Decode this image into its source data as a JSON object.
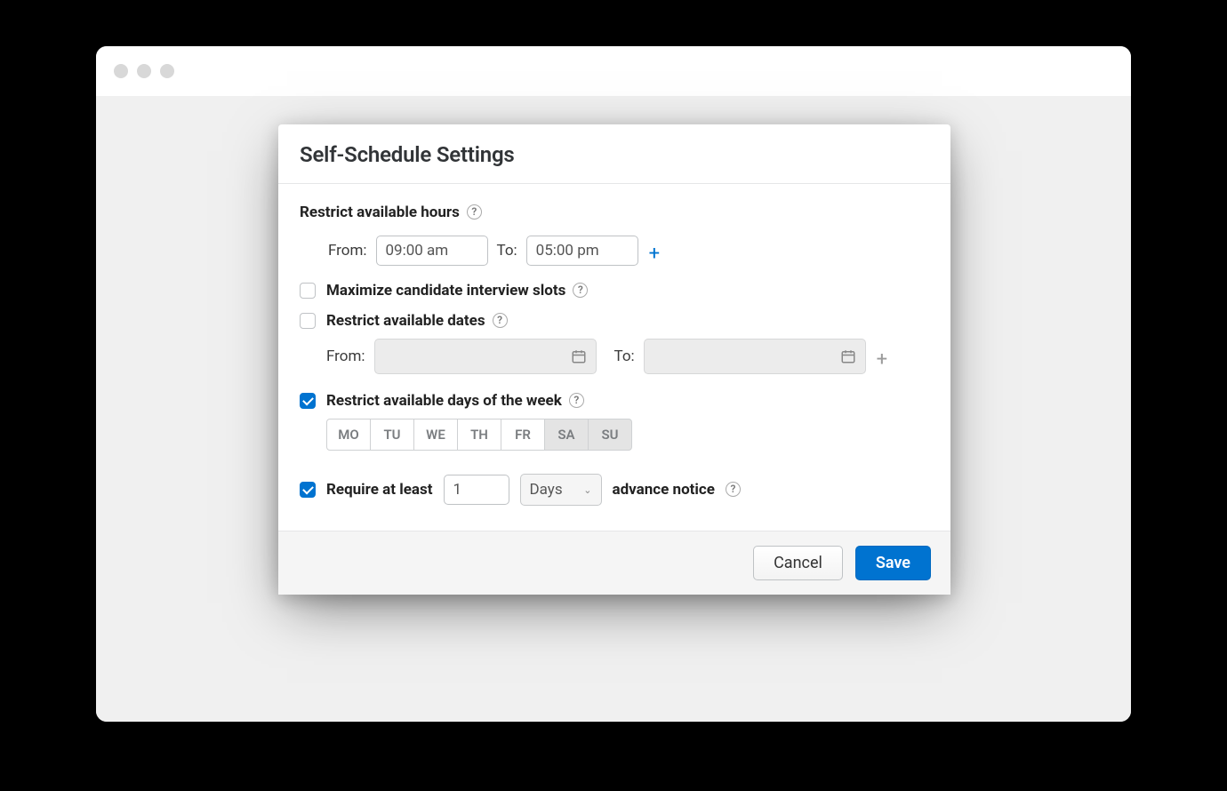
{
  "modal": {
    "title": "Self-Schedule Settings",
    "hours": {
      "label": "Restrict available hours",
      "from_label": "From:",
      "from_value": "09:00 am",
      "to_label": "To:",
      "to_value": "05:00 pm"
    },
    "maximize": {
      "checked": false,
      "label": "Maximize candidate interview slots"
    },
    "dates": {
      "checked": false,
      "label": "Restrict available dates",
      "from_label": "From:",
      "from_value": "",
      "to_label": "To:",
      "to_value": ""
    },
    "days": {
      "checked": true,
      "label": "Restrict available days of the week",
      "items": [
        {
          "abbr": "MO",
          "on": true
        },
        {
          "abbr": "TU",
          "on": true
        },
        {
          "abbr": "WE",
          "on": true
        },
        {
          "abbr": "TH",
          "on": true
        },
        {
          "abbr": "FR",
          "on": true
        },
        {
          "abbr": "SA",
          "on": false
        },
        {
          "abbr": "SU",
          "on": false
        }
      ]
    },
    "advance": {
      "checked": true,
      "label_before": "Require at least",
      "value": "1",
      "unit": "Days",
      "label_after": "advance notice"
    },
    "footer": {
      "cancel": "Cancel",
      "save": "Save"
    }
  },
  "help_glyph": "?"
}
